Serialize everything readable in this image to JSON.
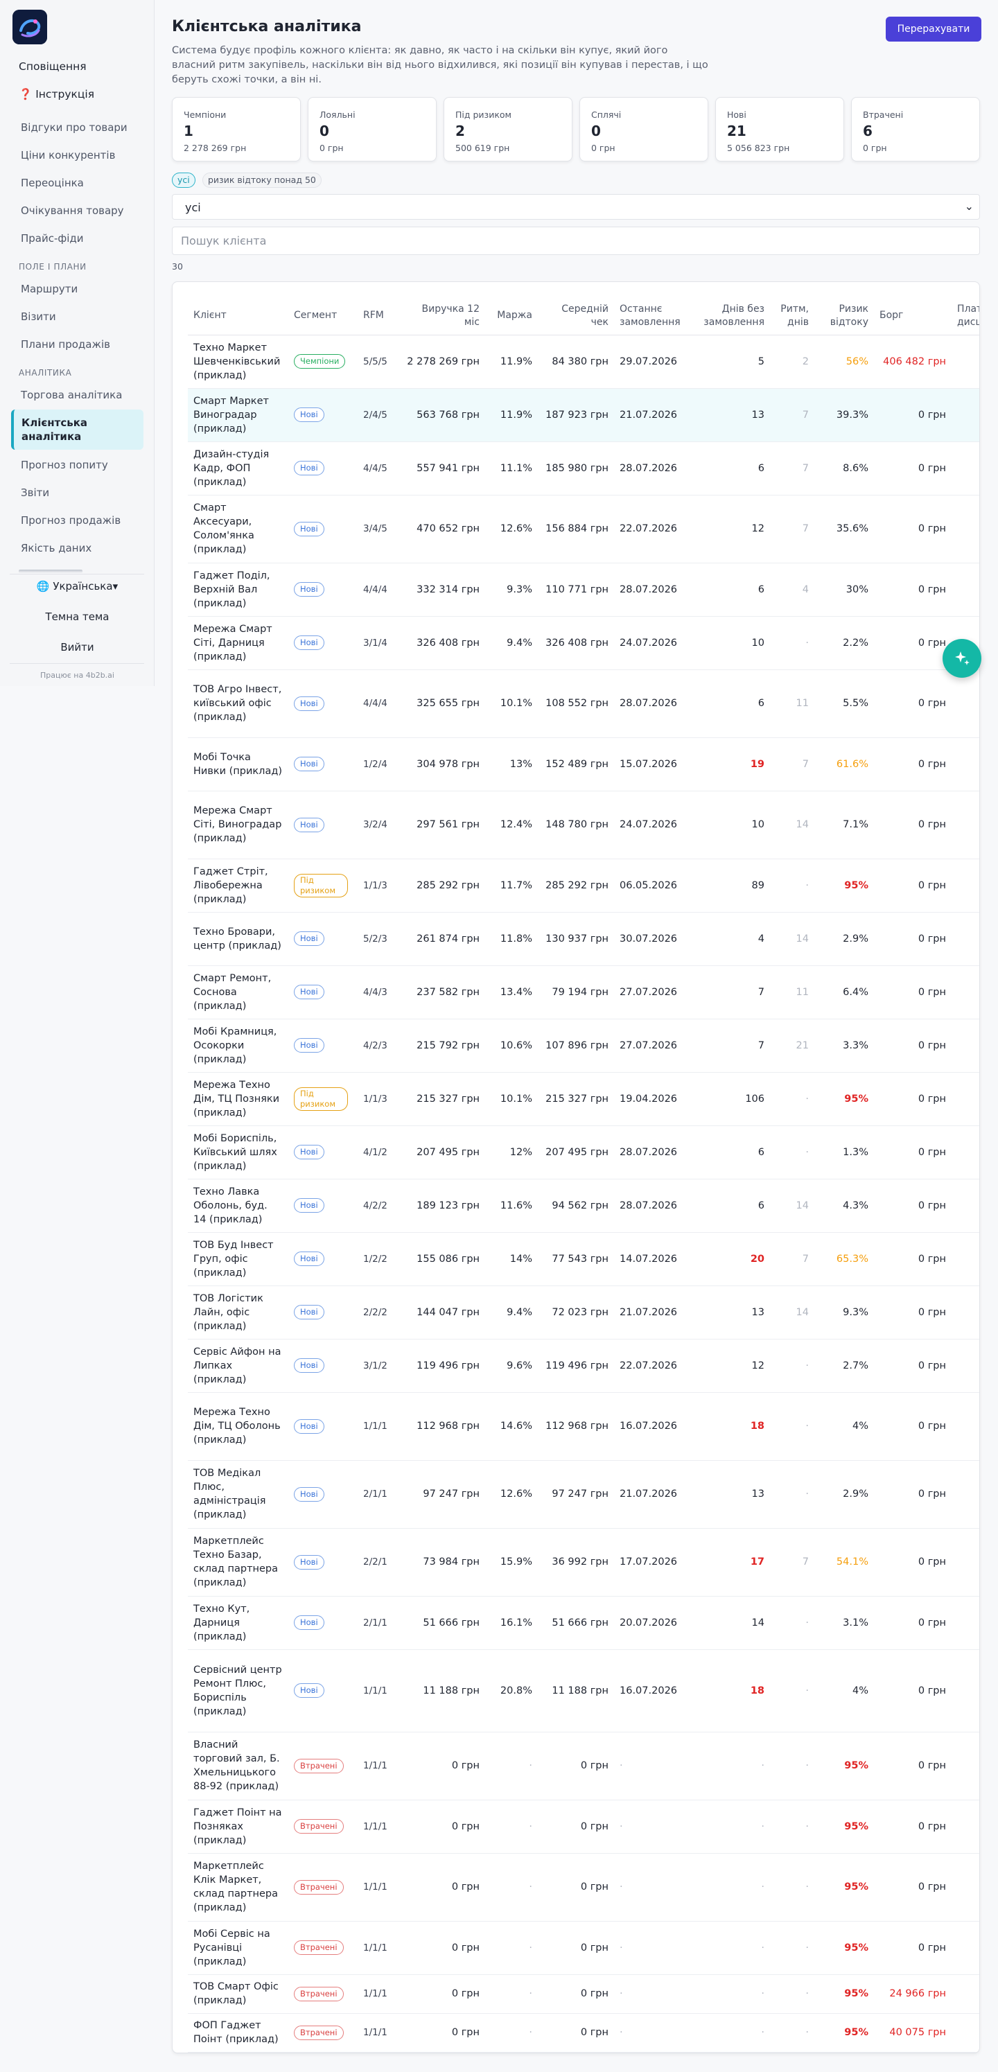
{
  "sidebar": {
    "top_items": [
      "Сповіщення",
      "❓ Інструкція"
    ],
    "items_a": [
      "Відгуки про товари",
      "Ціни конкурентів",
      "Переоцінка",
      "Очікування товару",
      "Прайс-фіди"
    ],
    "section_field": "Поле і плани",
    "items_b": [
      "Маршрути",
      "Візити",
      "Плани продажів"
    ],
    "section_analytics": "Аналітика",
    "item_trade": "Торгова аналітика",
    "item_active": "Клієнтська аналітика",
    "items_c": [
      "Прогноз попиту",
      "Звіти",
      "Прогноз продажів",
      "Якість даних"
    ],
    "language": "🌐 Українська▾",
    "theme": "Темна тема",
    "logout": "Вийти",
    "footer_note": "Працює на 4b2b.ai"
  },
  "header": {
    "title": "Клієнтська аналітика",
    "description": "Система будує профіль кожного клієнта: як давно, як часто і на скільки він купує, який його власний ритм закупівель, наскільки він від нього відхилився, які позиції він купував і перестав, і що беруть схожі точки, а він ні.",
    "recalc_button": "Перерахувати"
  },
  "cards": [
    {
      "label": "Чемпіони",
      "count": "1",
      "sum": "2 278 269 грн"
    },
    {
      "label": "Лояльні",
      "count": "0",
      "sum": "0 грн"
    },
    {
      "label": "Під ризиком",
      "count": "2",
      "sum": "500 619 грн"
    },
    {
      "label": "Сплячі",
      "count": "0",
      "sum": "0 грн"
    },
    {
      "label": "Нові",
      "count": "21",
      "sum": "5 056 823 грн"
    },
    {
      "label": "Втрачені",
      "count": "6",
      "sum": "0 грн"
    }
  ],
  "filters": {
    "chip_all": "усі",
    "chip_risk": "ризик відтоку понад 50",
    "segment_value": "усі",
    "search_placeholder": "Пошук клієнта",
    "result_count": "30"
  },
  "table": {
    "columns": [
      "Клієнт",
      "Сегмент",
      "RFM",
      "Виручка 12 міс",
      "Маржа",
      "Середній чек",
      "Останнє замовлення",
      "Днів без замовлення",
      "Ритм, днів",
      "Ризик відтоку",
      "Борг",
      "Платіжна дисципліна"
    ],
    "rows": [
      {
        "name": "Техно Маркет Шевченківський (приклад)",
        "segment": "Чемпіони",
        "rfm": "5/5/5",
        "revenue": "2 278 269 грн",
        "margin": "11.9%",
        "avg": "84 380 грн",
        "last": "29.07.2026",
        "days": "5",
        "rhythm": "2",
        "risk": "56%",
        "debt": "406 482 грн"
      },
      {
        "name": "Смарт Маркет Виноградар (приклад)",
        "segment": "Нові",
        "rfm": "2/4/5",
        "revenue": "563 768 грн",
        "margin": "11.9%",
        "avg": "187 923 грн",
        "last": "21.07.2026",
        "days": "13",
        "rhythm": "7",
        "risk": "39.3%",
        "debt": "0 грн"
      },
      {
        "name": "Дизайн-студія Кадр, ФОП (приклад)",
        "segment": "Нові",
        "rfm": "4/4/5",
        "revenue": "557 941 грн",
        "margin": "11.1%",
        "avg": "185 980 грн",
        "last": "28.07.2026",
        "days": "6",
        "rhythm": "7",
        "risk": "8.6%",
        "debt": "0 грн"
      },
      {
        "name": "Смарт Аксесуари, Солом'янка (приклад)",
        "segment": "Нові",
        "rfm": "3/4/5",
        "revenue": "470 652 грн",
        "margin": "12.6%",
        "avg": "156 884 грн",
        "last": "22.07.2026",
        "days": "12",
        "rhythm": "7",
        "risk": "35.6%",
        "debt": "0 грн"
      },
      {
        "name": "Гаджет Поділ, Верхній Вал (приклад)",
        "segment": "Нові",
        "rfm": "4/4/4",
        "revenue": "332 314 грн",
        "margin": "9.3%",
        "avg": "110 771 грн",
        "last": "28.07.2026",
        "days": "6",
        "rhythm": "4",
        "risk": "30%",
        "debt": "0 грн"
      },
      {
        "name": "Мережа Смарт Сіті, Дарниця (приклад)",
        "segment": "Нові",
        "rfm": "3/1/4",
        "revenue": "326 408 грн",
        "margin": "9.4%",
        "avg": "326 408 грн",
        "last": "24.07.2026",
        "days": "10",
        "rhythm": "·",
        "risk": "2.2%",
        "debt": "0 грн"
      },
      {
        "name": "ТОВ Агро Інвест, київський офіс (приклад)",
        "segment": "Нові",
        "rfm": "4/4/4",
        "revenue": "325 655 грн",
        "margin": "10.1%",
        "avg": "108 552 грн",
        "last": "28.07.2026",
        "days": "6",
        "rhythm": "11",
        "risk": "5.5%",
        "debt": "0 грн"
      },
      {
        "name": "Мобі Точка Нивки (приклад)",
        "segment": "Нові",
        "rfm": "1/2/4",
        "revenue": "304 978 грн",
        "margin": "13%",
        "avg": "152 489 грн",
        "last": "15.07.2026",
        "days": "19",
        "rhythm": "7",
        "risk": "61.6%",
        "debt": "0 грн"
      },
      {
        "name": "Мережа Смарт Сіті, Виноградар (приклад)",
        "segment": "Нові",
        "rfm": "3/2/4",
        "revenue": "297 561 грн",
        "margin": "12.4%",
        "avg": "148 780 грн",
        "last": "24.07.2026",
        "days": "10",
        "rhythm": "14",
        "risk": "7.1%",
        "debt": "0 грн"
      },
      {
        "name": "Гаджет Стріт, Лівобережна (приклад)",
        "segment": "Під ризиком",
        "rfm": "1/1/3",
        "revenue": "285 292 грн",
        "margin": "11.7%",
        "avg": "285 292 грн",
        "last": "06.05.2026",
        "days": "89",
        "rhythm": "·",
        "risk": "95%",
        "debt": "0 грн"
      },
      {
        "name": "Техно Бровари, центр (приклад)",
        "segment": "Нові",
        "rfm": "5/2/3",
        "revenue": "261 874 грн",
        "margin": "11.8%",
        "avg": "130 937 грн",
        "last": "30.07.2026",
        "days": "4",
        "rhythm": "14",
        "risk": "2.9%",
        "debt": "0 грн"
      },
      {
        "name": "Смарт Ремонт, Соснова (приклад)",
        "segment": "Нові",
        "rfm": "4/4/3",
        "revenue": "237 582 грн",
        "margin": "13.4%",
        "avg": "79 194 грн",
        "last": "27.07.2026",
        "days": "7",
        "rhythm": "11",
        "risk": "6.4%",
        "debt": "0 грн"
      },
      {
        "name": "Мобі Крамниця, Осокорки (приклад)",
        "segment": "Нові",
        "rfm": "4/2/3",
        "revenue": "215 792 грн",
        "margin": "10.6%",
        "avg": "107 896 грн",
        "last": "27.07.2026",
        "days": "7",
        "rhythm": "21",
        "risk": "3.3%",
        "debt": "0 грн"
      },
      {
        "name": "Мережа Техно Дім, ТЦ Позняки (приклад)",
        "segment": "Під ризиком",
        "rfm": "1/1/3",
        "revenue": "215 327 грн",
        "margin": "10.1%",
        "avg": "215 327 грн",
        "last": "19.04.2026",
        "days": "106",
        "rhythm": "·",
        "risk": "95%",
        "debt": "0 грн"
      },
      {
        "name": "Мобі Бориспіль, Київський шлях (приклад)",
        "segment": "Нові",
        "rfm": "4/1/2",
        "revenue": "207 495 грн",
        "margin": "12%",
        "avg": "207 495 грн",
        "last": "28.07.2026",
        "days": "6",
        "rhythm": "·",
        "risk": "1.3%",
        "debt": "0 грн"
      },
      {
        "name": "Техно Лавка Оболонь, буд. 14 (приклад)",
        "segment": "Нові",
        "rfm": "4/2/2",
        "revenue": "189 123 грн",
        "margin": "11.6%",
        "avg": "94 562 грн",
        "last": "28.07.2026",
        "days": "6",
        "rhythm": "14",
        "risk": "4.3%",
        "debt": "0 грн"
      },
      {
        "name": "ТОВ Буд Інвест Груп, офіс (приклад)",
        "segment": "Нові",
        "rfm": "1/2/2",
        "revenue": "155 086 грн",
        "margin": "14%",
        "avg": "77 543 грн",
        "last": "14.07.2026",
        "days": "20",
        "rhythm": "7",
        "risk": "65.3%",
        "debt": "0 грн"
      },
      {
        "name": "ТОВ Логістик Лайн, офіс (приклад)",
        "segment": "Нові",
        "rfm": "2/2/2",
        "revenue": "144 047 грн",
        "margin": "9.4%",
        "avg": "72 023 грн",
        "last": "21.07.2026",
        "days": "13",
        "rhythm": "14",
        "risk": "9.3%",
        "debt": "0 грн"
      },
      {
        "name": "Сервіс Айфон на Липках (приклад)",
        "segment": "Нові",
        "rfm": "3/1/2",
        "revenue": "119 496 грн",
        "margin": "9.6%",
        "avg": "119 496 грн",
        "last": "22.07.2026",
        "days": "12",
        "rhythm": "·",
        "risk": "2.7%",
        "debt": "0 грн"
      },
      {
        "name": "Мережа Техно Дім, ТЦ Оболонь (приклад)",
        "segment": "Нові",
        "rfm": "1/1/1",
        "revenue": "112 968 грн",
        "margin": "14.6%",
        "avg": "112 968 грн",
        "last": "16.07.2026",
        "days": "18",
        "rhythm": "·",
        "risk": "4%",
        "debt": "0 грн"
      },
      {
        "name": "ТОВ Медікал Плюс, адміністрація (приклад)",
        "segment": "Нові",
        "rfm": "2/1/1",
        "revenue": "97 247 грн",
        "margin": "12.6%",
        "avg": "97 247 грн",
        "last": "21.07.2026",
        "days": "13",
        "rhythm": "·",
        "risk": "2.9%",
        "debt": "0 грн"
      },
      {
        "name": "Маркетплейс Техно Базар, склад партнера (приклад)",
        "segment": "Нові",
        "rfm": "2/2/1",
        "revenue": "73 984 грн",
        "margin": "15.9%",
        "avg": "36 992 грн",
        "last": "17.07.2026",
        "days": "17",
        "rhythm": "7",
        "risk": "54.1%",
        "debt": "0 грн"
      },
      {
        "name": "Техно Кут, Дарниця (приклад)",
        "segment": "Нові",
        "rfm": "2/1/1",
        "revenue": "51 666 грн",
        "margin": "16.1%",
        "avg": "51 666 грн",
        "last": "20.07.2026",
        "days": "14",
        "rhythm": "·",
        "risk": "3.1%",
        "debt": "0 грн"
      },
      {
        "name": "Сервісний центр Ремонт Плюс, Бориспіль (приклад)",
        "segment": "Нові",
        "rfm": "1/1/1",
        "revenue": "11 188 грн",
        "margin": "20.8%",
        "avg": "11 188 грн",
        "last": "16.07.2026",
        "days": "18",
        "rhythm": "·",
        "risk": "4%",
        "debt": "0 грн"
      },
      {
        "name": "Власний торговий зал, Б. Хмельницького 88-92 (приклад)",
        "segment": "Втрачені",
        "rfm": "1/1/1",
        "revenue": "0 грн",
        "margin": "·",
        "avg": "0 грн",
        "last": "·",
        "days": "·",
        "rhythm": "·",
        "risk": "95%",
        "debt": "0 грн"
      },
      {
        "name": "Гаджет Поінт на Позняках (приклад)",
        "segment": "Втрачені",
        "rfm": "1/1/1",
        "revenue": "0 грн",
        "margin": "·",
        "avg": "0 грн",
        "last": "·",
        "days": "·",
        "rhythm": "·",
        "risk": "95%",
        "debt": "0 грн"
      },
      {
        "name": "Маркетплейс Клік Маркет, склад партнера (приклад)",
        "segment": "Втрачені",
        "rfm": "1/1/1",
        "revenue": "0 грн",
        "margin": "·",
        "avg": "0 грн",
        "last": "·",
        "days": "·",
        "rhythm": "·",
        "risk": "95%",
        "debt": "0 грн"
      },
      {
        "name": "Мобі Сервіс на Русанівці (приклад)",
        "segment": "Втрачені",
        "rfm": "1/1/1",
        "revenue": "0 грн",
        "margin": "·",
        "avg": "0 грн",
        "last": "·",
        "days": "·",
        "rhythm": "·",
        "risk": "95%",
        "debt": "0 грн"
      },
      {
        "name": "ТОВ Смарт Офіс (приклад)",
        "segment": "Втрачені",
        "rfm": "1/1/1",
        "revenue": "0 грн",
        "margin": "·",
        "avg": "0 грн",
        "last": "·",
        "days": "·",
        "rhythm": "·",
        "risk": "95%",
        "debt": "24 966 грн"
      },
      {
        "name": "ФОП Гаджет Поінт (приклад)",
        "segment": "Втрачені",
        "rfm": "1/1/1",
        "revenue": "0 грн",
        "margin": "·",
        "avg": "0 грн",
        "last": "·",
        "days": "·",
        "rhythm": "·",
        "risk": "95%",
        "debt": "40 075 грн"
      }
    ]
  },
  "colors": {
    "accent": "#4a40d8",
    "teal": "#14b8a6",
    "danger": "#e02424",
    "warning": "#f59e0b",
    "success": "#27ae60",
    "info": "#3b74d8"
  },
  "icons": {
    "logo": "app-logo-icon",
    "fab": "sparkle-assistant-icon",
    "select_caret": "chevron-down-icon"
  }
}
